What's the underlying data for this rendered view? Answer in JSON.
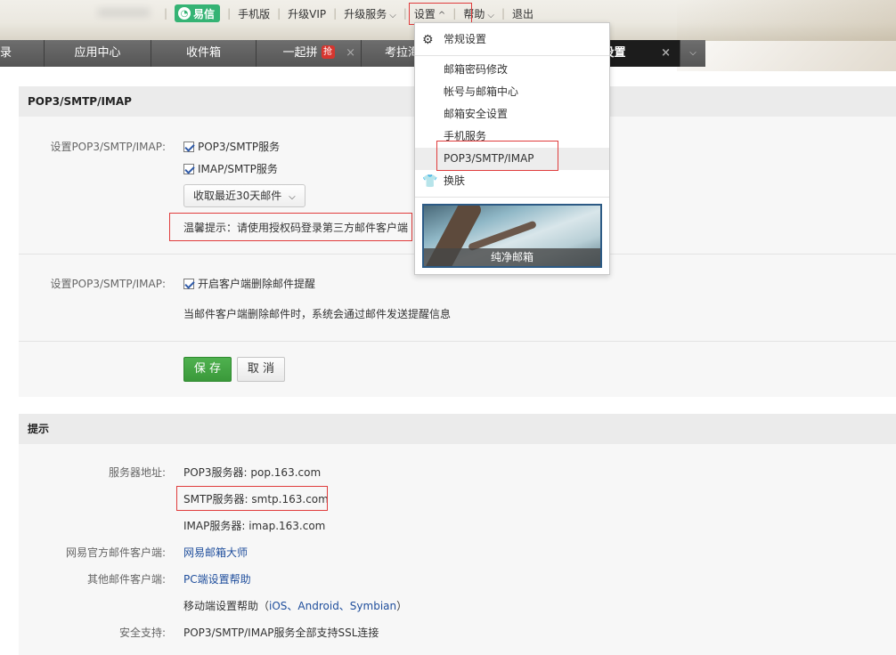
{
  "topnav": {
    "yixin": "易信",
    "mobile": "手机版",
    "vip": "升级VIP",
    "upgrade": "升级服务",
    "settings": "设置",
    "help": "帮助",
    "logout": "退出"
  },
  "tabs": [
    {
      "label": "录"
    },
    {
      "label": "应用中心"
    },
    {
      "label": "收件箱"
    },
    {
      "label": "一起拼",
      "badge": "抢"
    },
    {
      "label": "考拉海"
    },
    {
      "label": "设置",
      "active": true
    }
  ],
  "dropdown": {
    "general": "常规设置",
    "items": [
      "邮箱密码修改",
      "帐号与邮箱中心",
      "邮箱安全设置",
      "手机服务",
      "POP3/SMTP/IMAP"
    ],
    "skin": "换肤",
    "skin_name": "纯净邮箱"
  },
  "pop_panel": {
    "title": "POP3/SMTP/IMAP",
    "label1": "设置POP3/SMTP/IMAP:",
    "pop3_smtp": "POP3/SMTP服务",
    "imap_smtp": "IMAP/SMTP服务",
    "fetch_select": "收取最近30天邮件",
    "tip": "温馨提示：请使用授权码登录第三方邮件客户端",
    "label2": "设置POP3/SMTP/IMAP:",
    "delete_notice": "开启客户端删除邮件提醒",
    "delete_desc": "当邮件客户端删除邮件时，系统会通过邮件发送提醒信息",
    "save": "保 存",
    "cancel": "取 消"
  },
  "tips_panel": {
    "title": "提示",
    "server_label": "服务器地址:",
    "pop3": "POP3服务器: pop.163.com",
    "smtp": "SMTP服务器: smtp.163.com",
    "imap": "IMAP服务器: imap.163.com",
    "official_label": "网易官方邮件客户端:",
    "official_link": "网易邮箱大师",
    "other_label": "其他邮件客户端:",
    "pc_help": "PC端设置帮助",
    "mobile_help_prefix": "移动端设置帮助（",
    "mobile_help_links": "iOS、Android、Symbian",
    "mobile_help_suffix": "）",
    "security_label": "安全支持:",
    "security_text": "POP3/SMTP/IMAP服务全部支持SSL连接"
  },
  "colors": {
    "accent_green": "#35b374",
    "highlight_red": "#e03c3c",
    "link_blue": "#1f4e9c",
    "tab_active": "#1c1c1c"
  }
}
